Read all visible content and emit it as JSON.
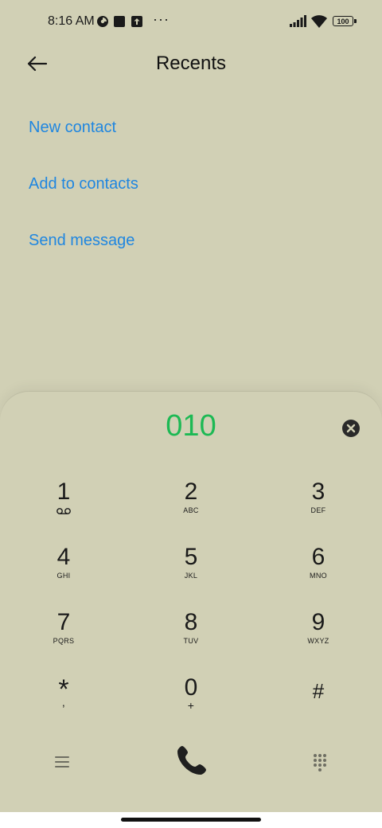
{
  "status_bar": {
    "time": "8:16 AM",
    "icons_left": [
      "data-saver-icon",
      "square-notification-icon",
      "upload-icon"
    ],
    "more": "···",
    "battery": "100",
    "icons_right": [
      "signal-icon",
      "wifi-icon",
      "battery-icon"
    ]
  },
  "header": {
    "title": "Recents",
    "back_icon": "back-arrow-icon"
  },
  "actions": {
    "new_contact": "New contact",
    "add_to_contacts": "Add to contacts",
    "send_message": "Send message"
  },
  "dialer": {
    "number": "010",
    "clear_icon": "clear-icon",
    "keys": [
      {
        "digit": "1",
        "letters": ""
      },
      {
        "digit": "2",
        "letters": "ABC"
      },
      {
        "digit": "3",
        "letters": "DEF"
      },
      {
        "digit": "4",
        "letters": "GHI"
      },
      {
        "digit": "5",
        "letters": "JKL"
      },
      {
        "digit": "6",
        "letters": "MNO"
      },
      {
        "digit": "7",
        "letters": "PQRS"
      },
      {
        "digit": "8",
        "letters": "TUV"
      },
      {
        "digit": "9",
        "letters": "WXYZ"
      },
      {
        "digit": "*",
        "letters": ","
      },
      {
        "digit": "0",
        "letters": "+"
      },
      {
        "digit": "#",
        "letters": ""
      }
    ],
    "bottom_icons": [
      "menu-icon",
      "phone-call-icon",
      "dialpad-icon"
    ]
  },
  "colors": {
    "background": "#d1d0b5",
    "accent_link": "#1f86e0",
    "dialed_number": "#1db954"
  }
}
